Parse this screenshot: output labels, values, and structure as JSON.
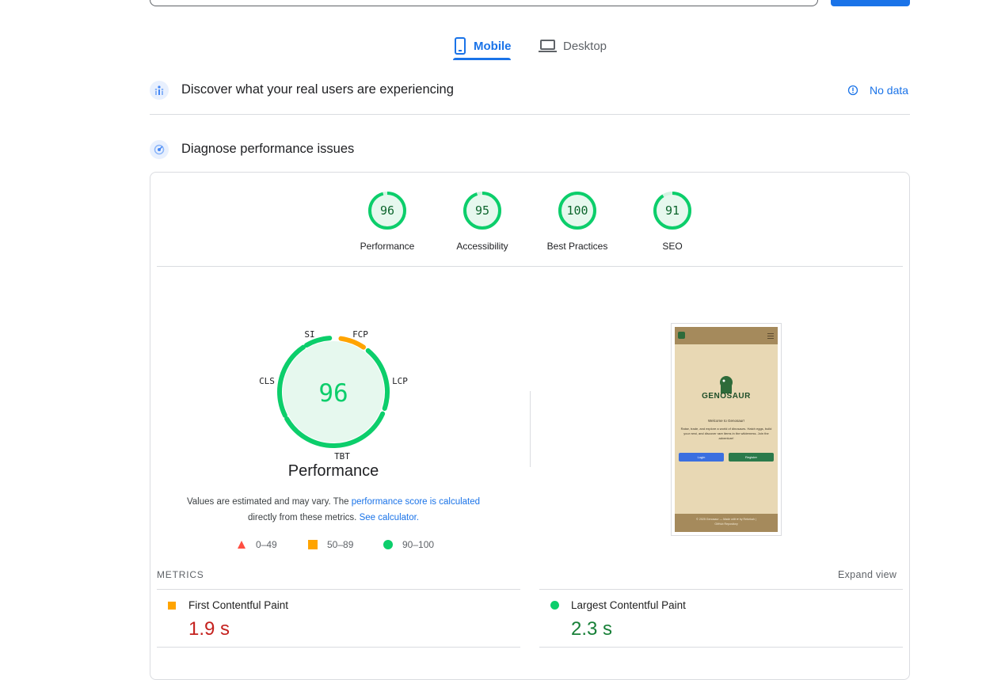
{
  "tabs": [
    {
      "label": "Mobile",
      "active": true,
      "icon": "smartphone-icon"
    },
    {
      "label": "Desktop",
      "active": false,
      "icon": "laptop-icon"
    }
  ],
  "field_data": {
    "title": "Discover what your real users are experiencing",
    "status": "No data"
  },
  "diagnose": {
    "title": "Diagnose performance issues"
  },
  "categories": [
    {
      "label": "Performance",
      "score": "96",
      "fraction": 0.96
    },
    {
      "label": "Accessibility",
      "score": "95",
      "fraction": 0.95
    },
    {
      "label": "Best Practices",
      "score": "100",
      "fraction": 1.0
    },
    {
      "label": "SEO",
      "score": "91",
      "fraction": 0.91
    }
  ],
  "perf": {
    "score": "96",
    "title": "Performance",
    "labels": {
      "si": "SI",
      "fcp": "FCP",
      "lcp": "LCP",
      "tbt": "TBT",
      "cls": "CLS"
    },
    "note_prefix": "Values are estimated and may vary. The ",
    "note_link1": "performance score is calculated",
    "note_mid": "directly from these metrics. ",
    "note_link2": "See calculator."
  },
  "legend": [
    {
      "range": "0–49",
      "shape": "triangle",
      "color": "#ff4e42"
    },
    {
      "range": "50–89",
      "shape": "square",
      "color": "#ffa400"
    },
    {
      "range": "90–100",
      "shape": "circle",
      "color": "#0cce6b"
    }
  ],
  "screenshot": {
    "headline": "GENOSAUR",
    "welcome": "Welcome to Genosaur!",
    "body": "Raise, trade, and explore a world of dinosaurs. Hatch eggs, build your nest, and discover rare items in the wilderness. Join the adventure!",
    "login": "Login",
    "register": "Register",
    "footer1": "© 2025 Genosaur — Made with ♥ by Rebekah |",
    "footer2": "GitHub Repository"
  },
  "metrics": {
    "heading": "METRICS",
    "expand": "Expand view",
    "items": [
      {
        "name": "First Contentful Paint",
        "value": "1.9 s",
        "color": "#c5221f",
        "marker": "square",
        "marker_color": "#ffa400"
      },
      {
        "name": "Largest Contentful Paint",
        "value": "2.3 s",
        "color": "#188038",
        "marker": "circle",
        "marker_color": "#0cce6b"
      }
    ]
  },
  "colors": {
    "accent": "#1a73e8",
    "pass": "#0cce6b",
    "average": "#ffa400",
    "fail": "#ff4e42",
    "pass_text": "#0d652d"
  }
}
